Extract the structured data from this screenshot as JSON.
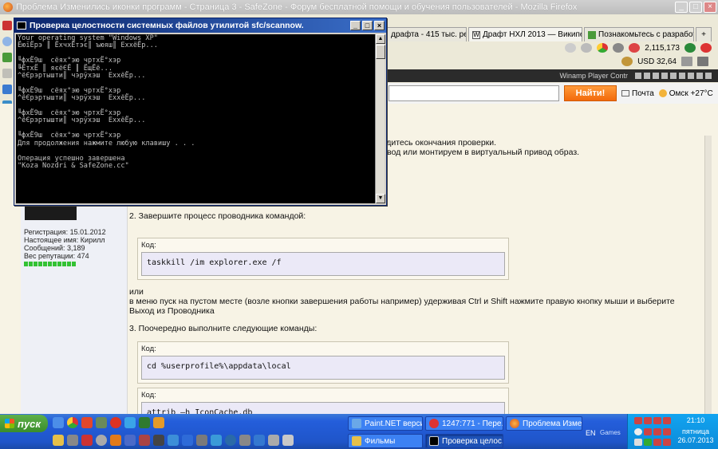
{
  "firefox": {
    "title": "Проблема Изменились иконки программ - Страница 3 - SafeZone - Форум бесплатной помощи и обучения пользователей - Mozilla Firefox",
    "tabs": [
      {
        "label": "драфта - 415 тыс. рез..."
      },
      {
        "label": "Драфт НХЛ 2013 — Википедия"
      },
      {
        "label": "Познакомьтесь с разработчик..."
      }
    ],
    "tabs_add": "+",
    "counter": "2,115,173",
    "usd": "USD 32,64",
    "winamp_title": "Winamp Player Contr",
    "search": {
      "value": "",
      "button": "Найти!",
      "mail": "Почта",
      "weather": "Омск +27°C"
    }
  },
  "cmd": {
    "title": "Проверка целостности системных файлов утилитой sfc/scannow.",
    "lines": [
      "Your operating system \"Windows XP\"",
      "ЁюїЁрэ ║ ЁхчхЁтэє║ ъюяш║ ЕххёЁр...",
      "",
      "╙фхЁ9ш  сёях°эю чртхЁ°хэр",
      "╚ЁтхЁ ║ яєёЄЁ ║ ЁщЁё...",
      "^ёЄрэртышти║ чэрўхэш  ЕххёЁр...",
      "",
      "╙фхЁ9ш  сёях°эю чртхЁ°хэр",
      "^ёЄрэртышти║ чэрўхэш  ЕххёЁр...",
      "",
      "╙фхЁ9ш  сёях°эю чртхЁ°хэр",
      "^ёЄрэртышти║ чэрўхэш  ЕххёЁр...",
      "",
      "╙фхЁ9ш  сёях°эю чртхЁ°хэр",
      "Для продолжения нажмите любую клавишу . . .",
      "",
      "Операция успешно завершена",
      "\"Koza Nozdri & SafeZone.cc\""
    ]
  },
  "post": {
    "line1": "го,дождитесь окончания проверки.",
    "line2": "вод или монтируем в виртуальный привод образ.",
    "step2": "2. Завершите процесс проводника командой:",
    "code_label": "Код:",
    "code1": "taskkill /im explorer.exe /f",
    "or": "или",
    "alt": "в меню пуск на пустом месте (возле кнопки завершения работы например) удерживая Ctrl и Shift нажмите правую кнопку мыши и выберите",
    "alt2": "Выход из Проводника",
    "step3": "3. Поочередно выполните следующие команды:",
    "code2": "cd %userprofile%\\appdata\\local",
    "code3": "attrib –h IconCache.db"
  },
  "user": {
    "registered": "Регистрация: 15.01.2012",
    "realname": "Настоящее имя: Кирилл",
    "messages": "Сообщений: 3,189",
    "reputation": "Вес репутации: 474"
  },
  "taskbar": {
    "start": "пуск",
    "buttons": [
      {
        "label": "Paint.NET версия..."
      },
      {
        "label": "1247:771 - Пере..."
      },
      {
        "label": "Проблема Измен..."
      },
      {
        "label": "Фильмы"
      },
      {
        "label": "Проверка целос..."
      }
    ],
    "lang": "EN",
    "games": "Games",
    "time": "21:10",
    "day": "пятница",
    "date": "26.07.2013"
  },
  "colors": {
    "accent": "#f26a0c",
    "titlebar": "#0a246a",
    "taskbar": "#245edb"
  }
}
